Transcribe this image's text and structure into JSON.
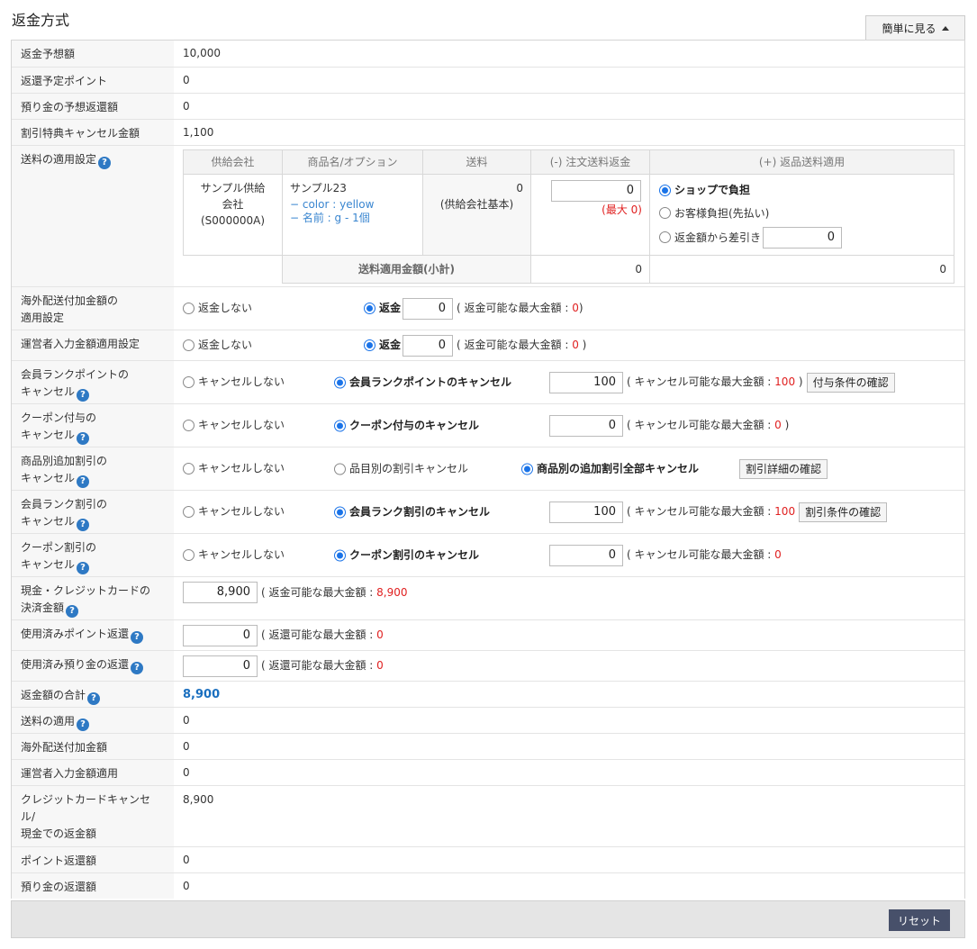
{
  "header": {
    "title": "返金方式",
    "toggle_label": "簡単に見る"
  },
  "rows": {
    "expected_refund": {
      "label": "返金予想額",
      "value": "10,000"
    },
    "return_points": {
      "label": "返還予定ポイント",
      "value": "0"
    },
    "deposit_return": {
      "label": "預り金の予想返還額",
      "value": "0"
    },
    "discount_cancel": {
      "label": "割引特典キャンセル金額",
      "value": "1,100"
    },
    "shipping": {
      "label": "送料の適用設定",
      "headers": [
        "供給会社",
        "商品名/オプション",
        "送料",
        "(-) 注文送料返金",
        "(+) 返品送料適用"
      ],
      "supplier": "サンプル供給会社 (S000000A)",
      "product": "サンプル23",
      "option1": "− color : yellow",
      "option2": "− 名前 : g - 1個",
      "fee": "0",
      "fee_note": "(供給会社基本)",
      "refund_value": "0",
      "refund_max": "(最大 0)",
      "radio1": "ショップで負担",
      "radio2": "お客様負担(先払い)",
      "radio3": "返金額から差引き",
      "radio3_value": "0",
      "subtotal_label": "送料適用金額(小計)",
      "subtotal1": "0",
      "subtotal2": "0"
    },
    "overseas": {
      "label1": "海外配送付加金額の",
      "label2": "適用設定",
      "opt_no": "返金しない",
      "opt_yes": "返金",
      "value": "0",
      "note_pre": "( 返金可能な最大金額 : ",
      "note_max": "0",
      "note_post": ")"
    },
    "operator": {
      "label": "運営者入力金額適用設定",
      "opt_no": "返金しない",
      "opt_yes": "返金",
      "value": "0",
      "note_pre": "( 返金可能な最大金額 : ",
      "note_max": "0",
      "note_post": " )"
    },
    "rank_points": {
      "label1": "会員ランクポイントの",
      "label2": "キャンセル",
      "opt_no": "キャンセルしない",
      "opt_yes": "会員ランクポイントのキャンセル",
      "value": "100",
      "note_pre": "( キャンセル可能な最大金額 : ",
      "note_max": "100",
      "note_post": " )",
      "button": "付与条件の確認"
    },
    "coupon_grant": {
      "label1": "クーポン付与の",
      "label2": "キャンセル",
      "opt_no": "キャンセルしない",
      "opt_yes": "クーポン付与のキャンセル",
      "value": "0",
      "note_pre": "( キャンセル可能な最大金額 : ",
      "note_max": "0",
      "note_post": " )"
    },
    "product_discount": {
      "label1": "商品別追加割引の",
      "label2": "キャンセル",
      "opt_no": "キャンセルしない",
      "opt_item": "品目別の割引キャンセル",
      "opt_all": "商品別の追加割引全部キャンセル",
      "button": "割引詳細の確認"
    },
    "rank_discount": {
      "label1": "会員ランク割引の",
      "label2": "キャンセル",
      "opt_no": "キャンセルしない",
      "opt_yes": "会員ランク割引のキャンセル",
      "value": "100",
      "note_pre": "( キャンセル可能な最大金額 : ",
      "note_max": "100",
      "note_post": "",
      "button": "割引条件の確認"
    },
    "coupon_discount": {
      "label1": "クーポン割引の",
      "label2": "キャンセル",
      "opt_no": "キャンセルしない",
      "opt_yes": "クーポン割引のキャンセル",
      "value": "0",
      "note_pre": "( キャンセル可能な最大金額 : ",
      "note_max": "0"
    },
    "cash_card": {
      "label1": "現金・クレジットカードの",
      "label2": "決済金額",
      "value": "8,900",
      "note_pre": "( 返金可能な最大金額 : ",
      "note_max": "8,900"
    },
    "used_points": {
      "label": "使用済みポイント返還",
      "value": "0",
      "note_pre": "( 返還可能な最大金額 : ",
      "note_max": "0"
    },
    "used_deposit": {
      "label": "使用済み預り金の返還",
      "value": "0",
      "note_pre": "( 返還可能な最大金額 : ",
      "note_max": "0"
    },
    "refund_total": {
      "label": "返金額の合計",
      "value": "8,900"
    },
    "shipping_applied": {
      "label": "送料の適用",
      "value": "0"
    },
    "overseas_amount": {
      "label": "海外配送付加金額",
      "value": "0"
    },
    "operator_applied": {
      "label": "運営者入力金額適用",
      "value": "0"
    },
    "card_cancel": {
      "label1": "クレジットカードキャンセ",
      "label2": "ル/",
      "label3": "現金での返金額",
      "value": "8,900"
    },
    "point_return": {
      "label": "ポイント返還額",
      "value": "0"
    },
    "deposit_refund": {
      "label": "預り金の返還額",
      "value": "0"
    }
  },
  "footer": {
    "reset_label": "リセット"
  },
  "colors": {
    "accent": "#1a73e8",
    "max_red": "#e02020",
    "total_blue": "#1a6fbf",
    "reset_bg": "#47506a"
  }
}
